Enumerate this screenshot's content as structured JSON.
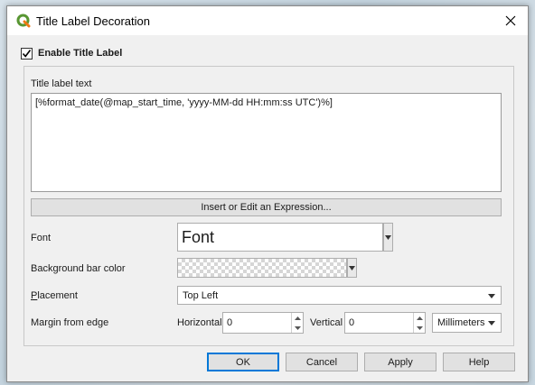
{
  "window": {
    "title": "Title Label Decoration"
  },
  "enable": {
    "label": "Enable Title Label",
    "checked": true
  },
  "title_label": {
    "label": "Title label text",
    "value": "[%format_date(@map_start_time, 'yyyy-MM-dd HH:mm:ss UTC')%]",
    "expression_button": "Insert or Edit an Expression..."
  },
  "font": {
    "label": "Font",
    "value": "Font"
  },
  "background": {
    "label": "Background bar color"
  },
  "placement": {
    "label_first": "P",
    "label_rest": "lacement",
    "value": "Top Left"
  },
  "margin": {
    "label": "Margin from edge",
    "horizontal_label": "Horizontal",
    "horizontal_value": "0",
    "vertical_label": "Vertical",
    "vertical_value": "0",
    "unit": "Millimeters"
  },
  "buttons": {
    "ok": "OK",
    "cancel": "Cancel",
    "apply": "Apply",
    "help": "Help"
  },
  "colors": {
    "logo": "#589632",
    "accent": "#0078d7"
  }
}
